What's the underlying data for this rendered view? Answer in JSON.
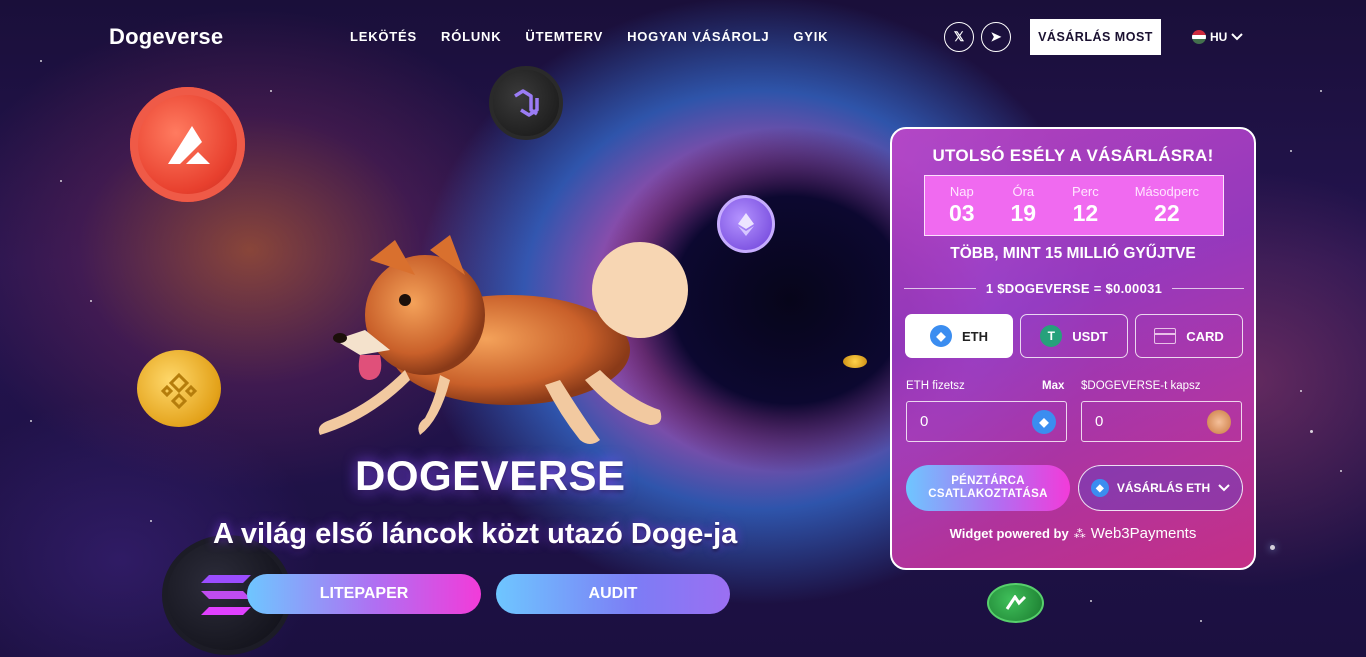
{
  "header": {
    "logo": "Dogeverse",
    "nav": [
      "LEKÖTÉS",
      "RÓLUNK",
      "ÜTEMTERV",
      "HOGYAN VÁSÁROLJ",
      "GYIK"
    ],
    "social": [
      {
        "icon": "x-icon",
        "label": "𝕏"
      },
      {
        "icon": "telegram-icon",
        "label": "➤"
      }
    ],
    "buy_now": "VÁSÁRLÁS MOST",
    "language": "HU",
    "flag_colors": [
      "#cd2a3e",
      "#ffffff",
      "#436f4d"
    ]
  },
  "hero": {
    "title": "DOGEVERSE",
    "subtitle": "A világ első láncok közt utazó Doge-ja",
    "litepaper": "LITEPAPER",
    "audit": "AUDIT"
  },
  "widget": {
    "heading": "UTOLSÓ ESÉLY A VÁSÁRLÁSRA!",
    "countdown": [
      {
        "label": "Nap",
        "value": "03"
      },
      {
        "label": "Óra",
        "value": "19"
      },
      {
        "label": "Perc",
        "value": "12"
      },
      {
        "label": "Másodperc",
        "value": "22"
      }
    ],
    "raised": "TÖBB, MINT 15 MILLIÓ GYŰJTVE",
    "rate": "1 $DOGEVERSE = $0.00031",
    "currencies": [
      {
        "label": "ETH",
        "icon": "eth-icon",
        "color": "#3b8df0"
      },
      {
        "label": "USDT",
        "icon": "tether-icon",
        "color": "#26a17b"
      },
      {
        "label": "CARD",
        "icon": "card-icon",
        "color": "#e04a8a"
      }
    ],
    "pay_label": "ETH fizetsz",
    "max_label": "Max",
    "receive_label": "$DOGEVERSE-t kapsz",
    "pay_value": "0",
    "receive_value": "0",
    "connect_wallet": "PÉNZTÁRCA CSATLAKOZTATÁSA",
    "buy_with": "VÁSÁRLÁS ETH",
    "powered_by": "Widget powered by",
    "provider": "Web3Payments"
  },
  "colors": {
    "accent_pink": "#f23bd9",
    "accent_blue": "#6ec6ff",
    "widget_bg": "#c04ac8"
  }
}
